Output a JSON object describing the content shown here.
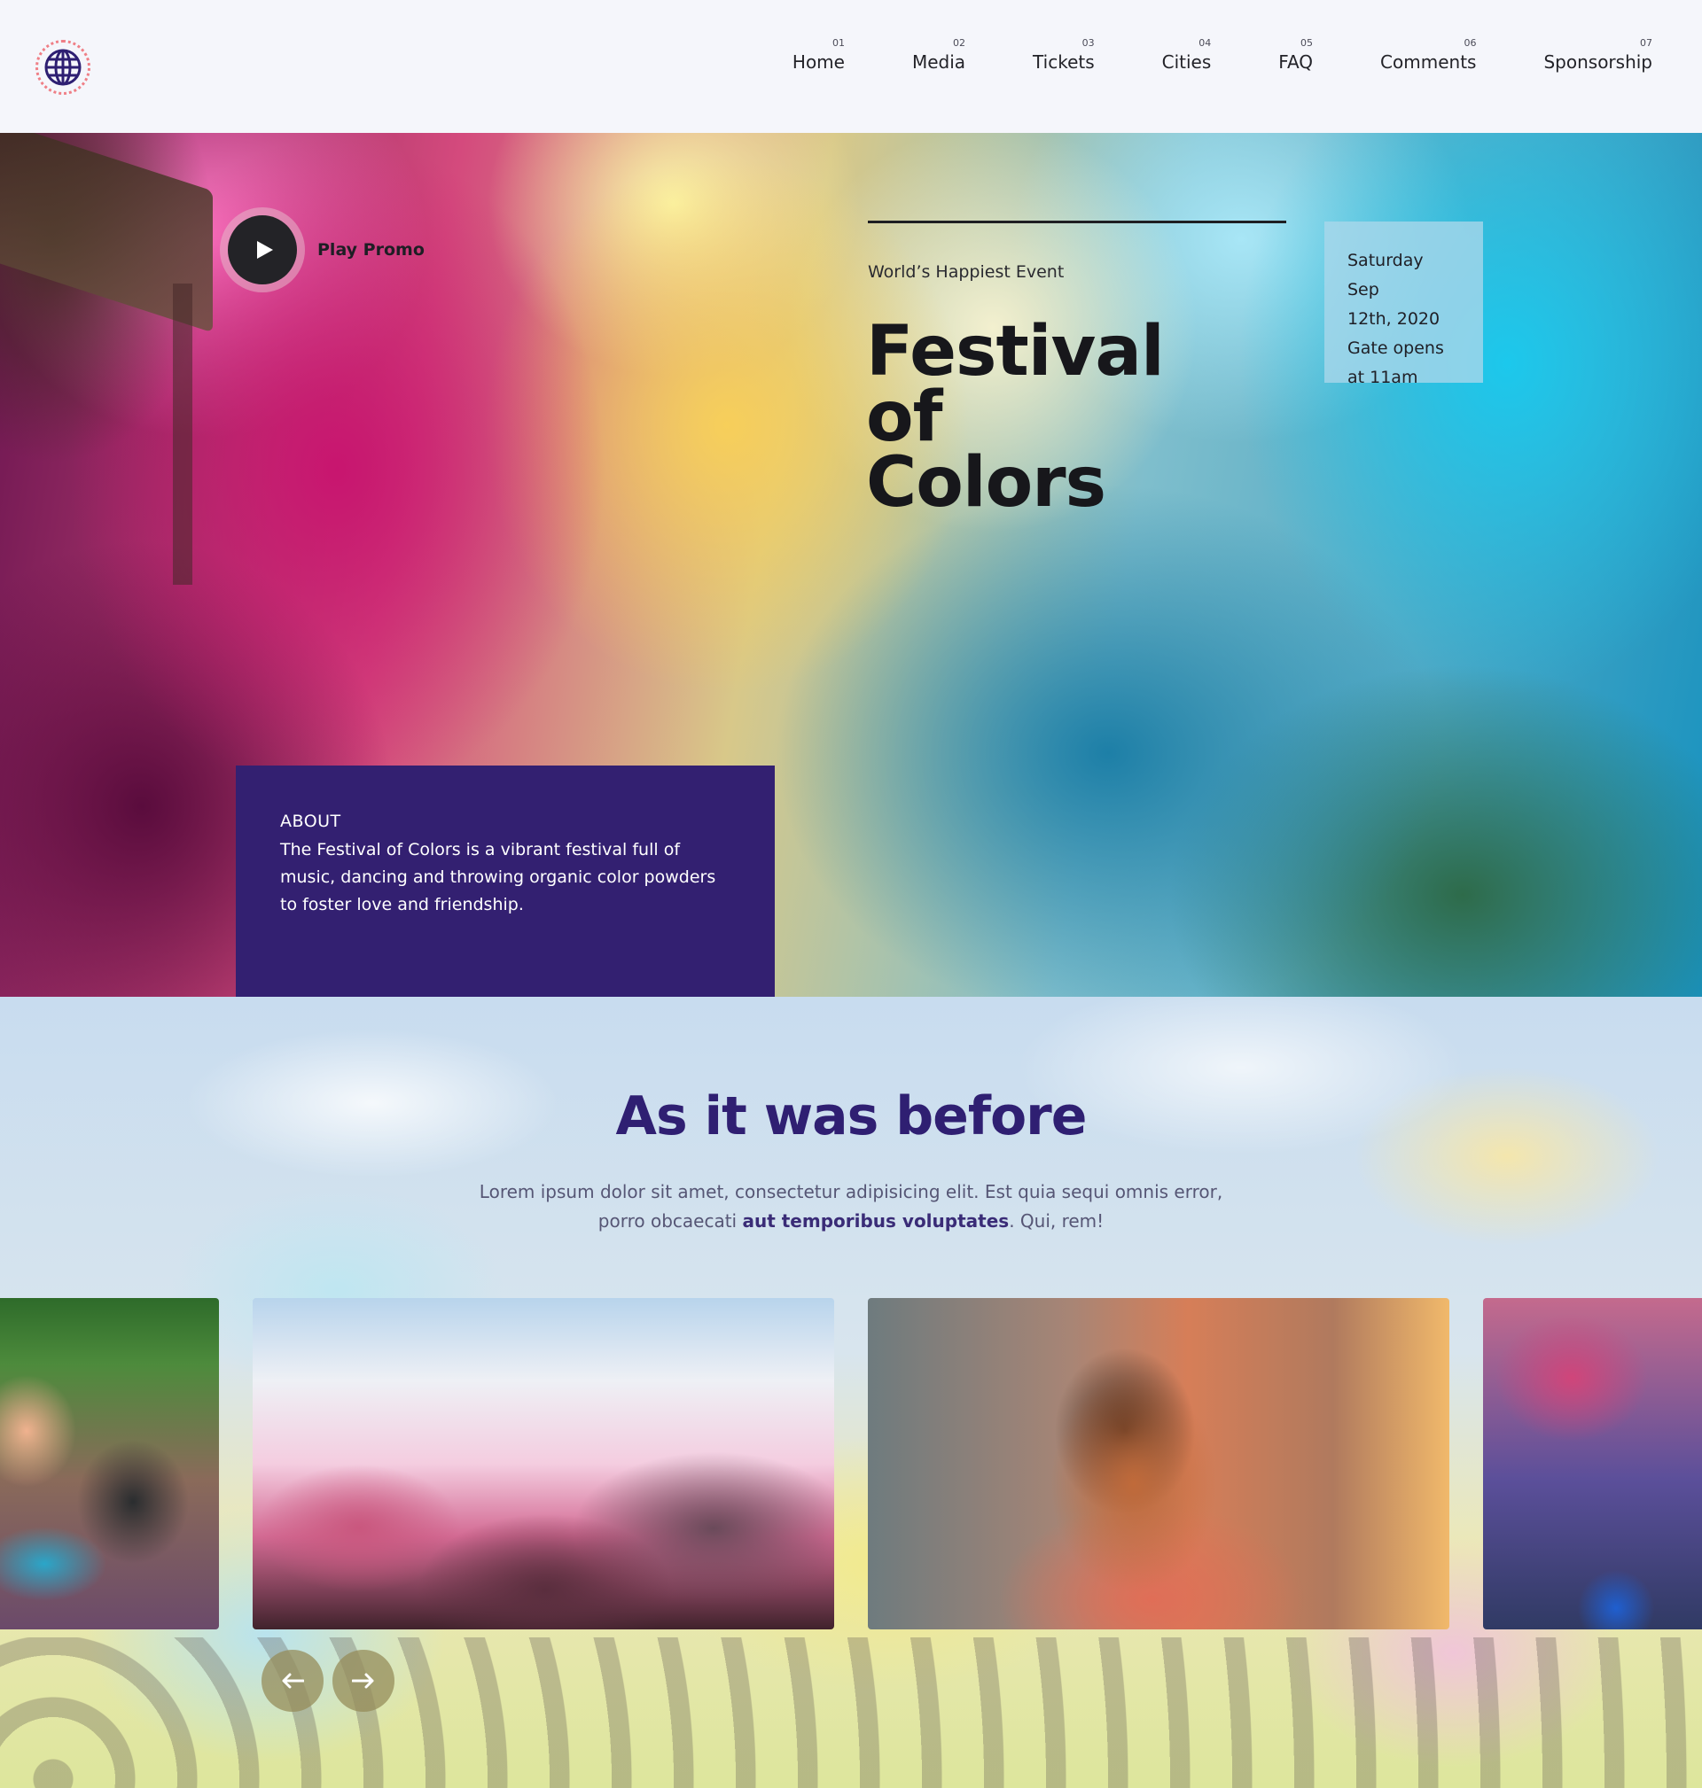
{
  "header": {
    "logo_icon": "globe-icon",
    "nav": [
      {
        "num": "01",
        "label": "Home"
      },
      {
        "num": "02",
        "label": "Media"
      },
      {
        "num": "03",
        "label": "Tickets"
      },
      {
        "num": "04",
        "label": "Cities"
      },
      {
        "num": "05",
        "label": "FAQ"
      },
      {
        "num": "06",
        "label": "Comments"
      },
      {
        "num": "07",
        "label": "Sponsorship"
      }
    ]
  },
  "hero": {
    "promo_label": "Play Promo",
    "eyebrow": "World’s Happiest Event",
    "title_line1": "Festival of",
    "title_line2": "Colors",
    "date_lines": [
      "Saturday Sep",
      "12th, 2020",
      "Gate opens",
      "at 11am"
    ],
    "about": {
      "heading": "ABOUT",
      "text": "The Festival of Colors is a vibrant festival full of music, dancing and throwing organic color powders to foster love and friendship."
    }
  },
  "gallery": {
    "title": "As it was before",
    "text_before": "Lorem ipsum dolor sit amet, consectetur adipisicing elit. Est quia sequi omnis error, porro obcaecati ",
    "text_bold": "aut temporibus voluptates",
    "text_after": ". Qui, rem!",
    "prev_icon": "arrow-left-icon",
    "next_icon": "arrow-right-icon"
  },
  "colors": {
    "accent": "#332071",
    "title": "#2f1f72",
    "logo_ring": "#ef7f86"
  }
}
